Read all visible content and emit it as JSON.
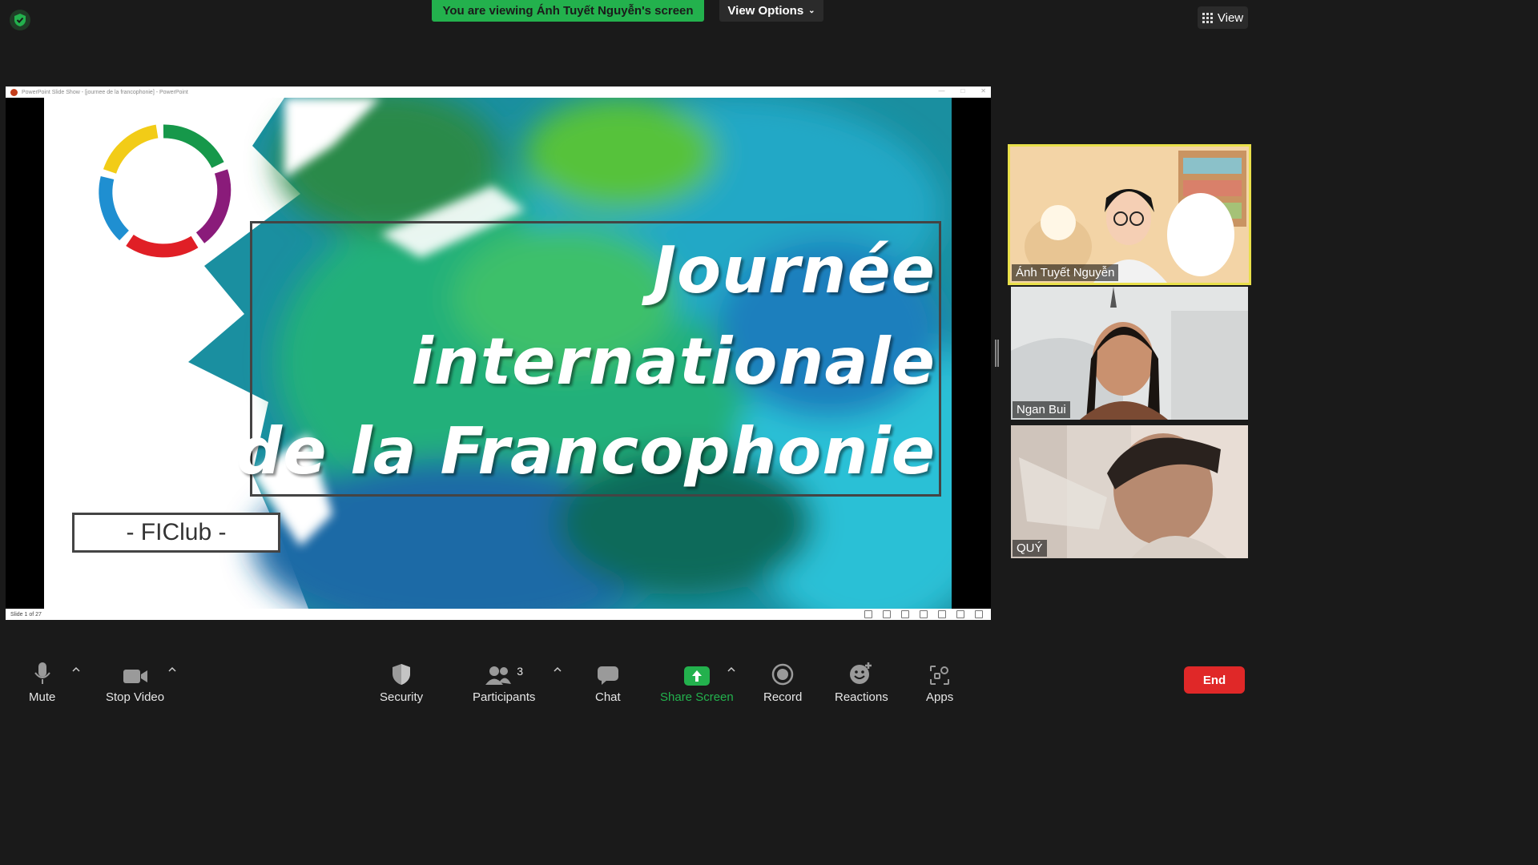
{
  "top": {
    "banner": "You are viewing Ánh Tuyết Nguyễn's screen",
    "view_options": "View Options",
    "view_label": "View"
  },
  "share": {
    "window_title": "PowerPoint Slide Show - [journee de la francophonie] - PowerPoint",
    "slide_status": "Slide 1 of 27",
    "slide": {
      "title_lines": [
        "Journée",
        "internationale",
        "de la Francophonie"
      ],
      "club": "- FIClub -"
    }
  },
  "participants_tiles": [
    {
      "name": "Ánh Tuyết Nguyễn"
    },
    {
      "name": "Ngan Bui"
    },
    {
      "name": "QUÝ"
    }
  ],
  "toolbar": {
    "mute": "Mute",
    "stop_video": "Stop Video",
    "security": "Security",
    "participants": "Participants",
    "participants_count": "3",
    "chat": "Chat",
    "share_screen": "Share Screen",
    "record": "Record",
    "reactions": "Reactions",
    "apps": "Apps",
    "end": "End"
  },
  "colors": {
    "banner_green": "#23b14d",
    "share_green": "#23b14d",
    "end_red": "#e02828",
    "active_speaker": "#e9e04a"
  }
}
